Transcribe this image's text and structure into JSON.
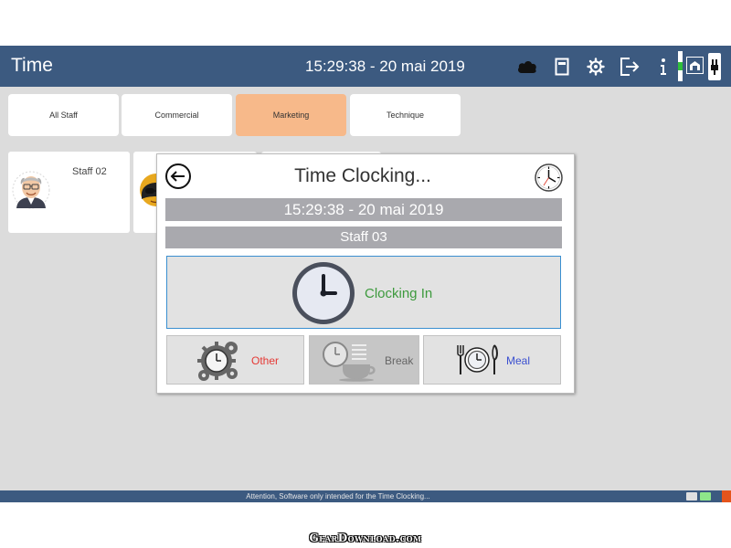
{
  "header": {
    "title": "Time",
    "datetime": "15:29:38 - 20 mai 2019",
    "icons": [
      "cloud-icon",
      "notebook-icon",
      "gear-icon",
      "logout-icon",
      "info-icon",
      "network-icon",
      "power-plug-icon"
    ]
  },
  "tabs": [
    {
      "label": "All Staff",
      "active": false
    },
    {
      "label": "Commercial",
      "active": false
    },
    {
      "label": "Marketing",
      "active": true
    },
    {
      "label": "Technique",
      "active": false
    }
  ],
  "staff": [
    {
      "name": "Staff 02"
    }
  ],
  "dialog": {
    "title": "Time Clocking...",
    "datetime": "15:29:38 - 20 mai 2019",
    "staff_name": "Staff 03",
    "clock_in_label": "Clocking In",
    "options": [
      {
        "label": "Other",
        "color": "#e53935"
      },
      {
        "label": "Break",
        "color": "#666666"
      },
      {
        "label": "Meal",
        "color": "#3a4fd0"
      }
    ]
  },
  "footer": {
    "message": "Attention, Software only intended for the  Time Clocking..."
  },
  "watermark": "GearDownload.com",
  "colors": {
    "header": "#3c5a80",
    "active_tab": "#f7b98a",
    "clock_in_text": "#3d9a3d",
    "clock_in_border": "#3a8fd0"
  }
}
